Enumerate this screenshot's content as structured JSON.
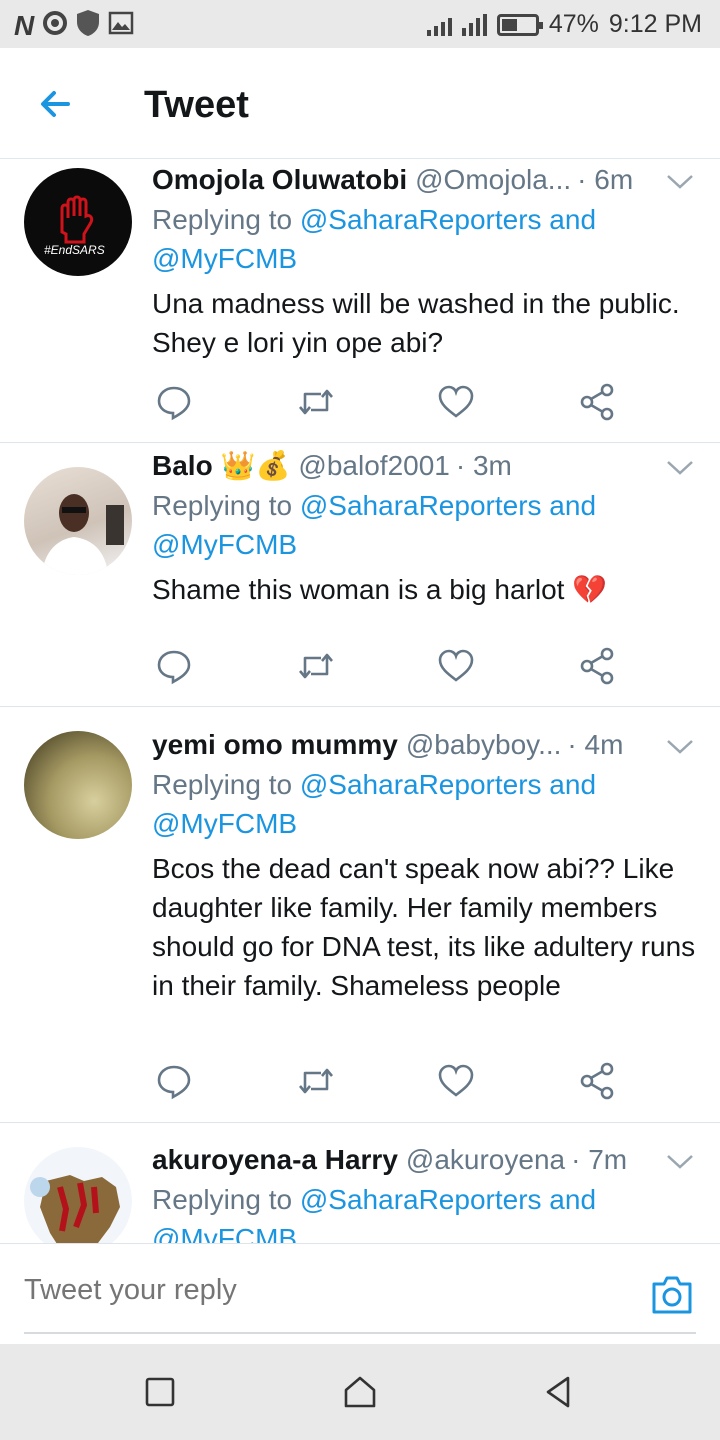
{
  "status_bar": {
    "carrier_mark": "N",
    "battery": "47%",
    "battery_level": 0.47,
    "time": "9:12 PM"
  },
  "header": {
    "title": "Tweet"
  },
  "tweets": [
    {
      "name": "Omojola Oluwatobi",
      "handle": "@Omojola...",
      "time": "· 6m",
      "replying_prefix": "Replying to ",
      "replying_to": "@SaharaReporters and @MyFCMB",
      "text": "Una madness will be washed in the public. Shey e lori yin ope abi?",
      "avatar_label": "#EndSARS"
    },
    {
      "name": "Balo",
      "name_emoji": "👑💰",
      "handle": "@balof2001",
      "time": "· 3m",
      "replying_prefix": "Replying to ",
      "replying_to": "@SaharaReporters and @MyFCMB",
      "text": "Shame this woman is a big harlot 💔"
    },
    {
      "name": "yemi omo mummy",
      "handle": "@babyboy...",
      "time": "· 4m",
      "replying_prefix": "Replying to ",
      "replying_to": "@SaharaReporters and @MyFCMB",
      "text": "Bcos the dead can't speak now abi?? Like daughter like family. Her family members should go for DNA test, its like adultery runs in their family. Shameless people"
    },
    {
      "name": "akuroyena-a Harry",
      "handle": "@akuroyena",
      "time": "· 7m",
      "replying_prefix": "Replying to ",
      "replying_to": "@SaharaReporters and @MyFCMB"
    }
  ],
  "reply_bar": {
    "placeholder": "Tweet your reply"
  },
  "colors": {
    "accent": "#1b95e0",
    "secondary_text": "#657786"
  },
  "icons": [
    "back-arrow-icon",
    "chevron-down-icon",
    "reply-icon",
    "retweet-icon",
    "like-icon",
    "share-icon",
    "camera-icon",
    "recent-apps-icon",
    "home-icon",
    "back-icon"
  ]
}
